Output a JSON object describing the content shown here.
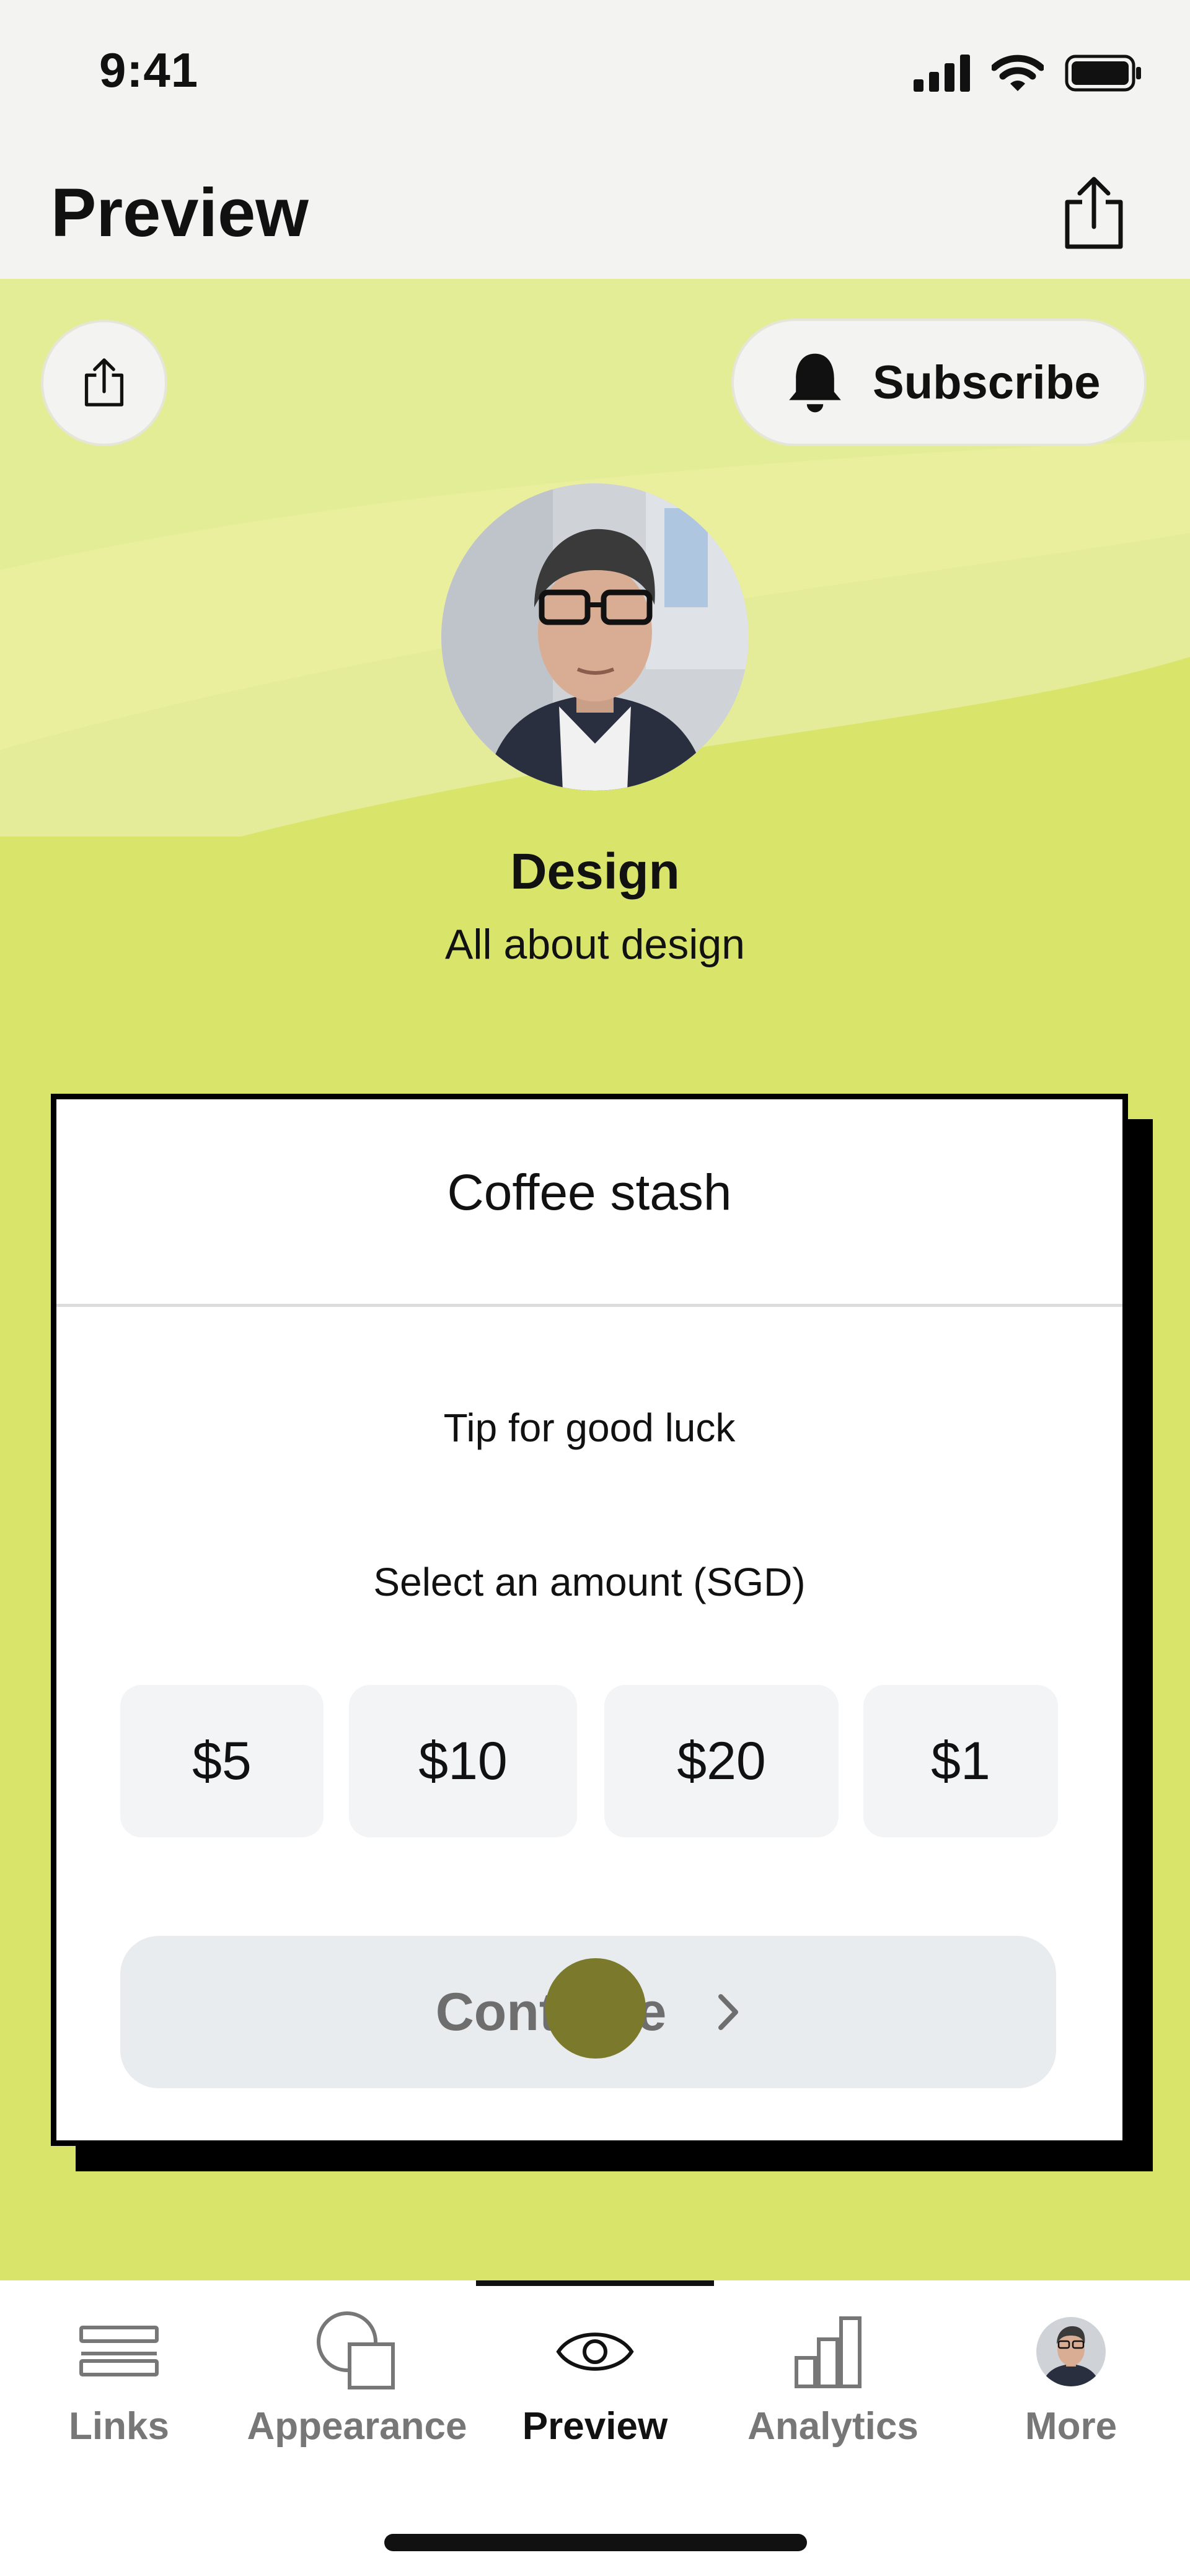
{
  "status_bar": {
    "time": "9:41",
    "icons": [
      "cellular-signal-icon",
      "wifi-icon",
      "battery-icon"
    ]
  },
  "header": {
    "title": "Preview",
    "share_icon": "share-icon"
  },
  "profile": {
    "subscribe_label": "Subscribe",
    "name": "Design",
    "bio": "All about design"
  },
  "tip_card": {
    "title": "Coffee stash",
    "tip_text": "Tip for good luck",
    "select_label": "Select an amount (SGD)",
    "amounts": [
      "$5",
      "$10",
      "$20",
      "$1"
    ],
    "continue_label": "Continue"
  },
  "tabs": [
    {
      "label": "Links",
      "icon": "links-icon",
      "active": false
    },
    {
      "label": "Appearance",
      "icon": "appearance-icon",
      "active": false
    },
    {
      "label": "Preview",
      "icon": "eye-icon",
      "active": true
    },
    {
      "label": "Analytics",
      "icon": "analytics-icon",
      "active": false
    },
    {
      "label": "More",
      "icon": "avatar",
      "active": false
    }
  ],
  "colors": {
    "preview_background": "#d9e56a",
    "header_background": "#f3f3f2",
    "card_border": "#000000",
    "continue_button": "#e9ecef",
    "amount_button": "#f3f4f6"
  }
}
